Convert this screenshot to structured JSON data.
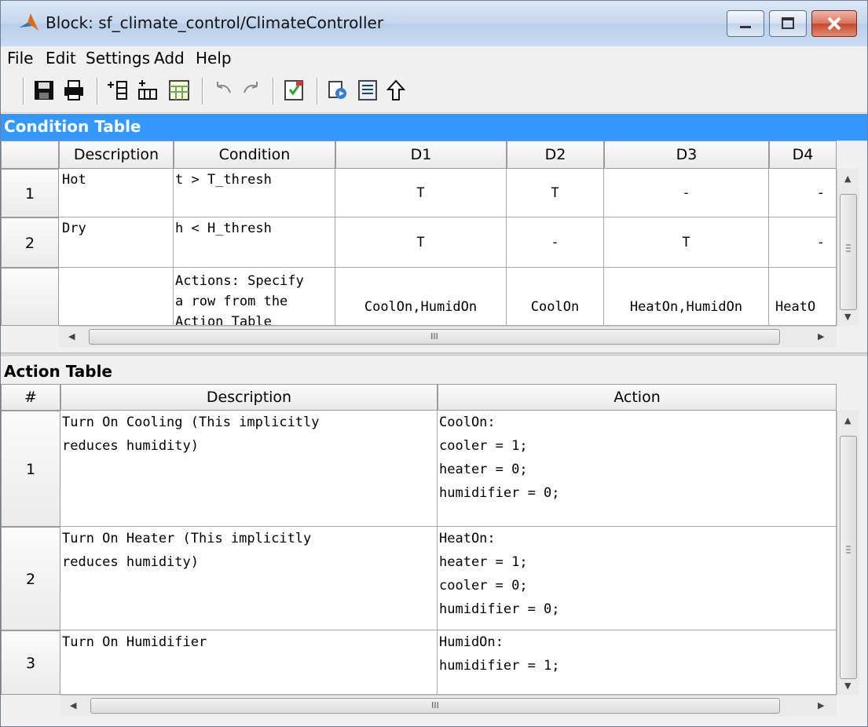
{
  "window": {
    "title": "Block: sf_climate_control/ClimateController"
  },
  "menu": [
    "File",
    "Edit",
    "Settings",
    "Add",
    "Help"
  ],
  "toolbar": [
    "save-icon",
    "print-icon",
    "insert-row-icon",
    "insert-column-icon",
    "table-icon",
    "undo-icon",
    "redo-icon",
    "check-icon",
    "run-icon",
    "data-icon",
    "up-arrow-icon"
  ],
  "condition_table": {
    "label": "Condition Table",
    "headers": [
      "Description",
      "Condition",
      "D1",
      "D2",
      "D3",
      "D4"
    ],
    "rows": [
      {
        "num": "1",
        "description": "Hot",
        "condition": "t > T_thresh",
        "decisions": [
          "T",
          "T",
          "-",
          "-"
        ]
      },
      {
        "num": "2",
        "description": "Dry",
        "condition": "h < H_thresh",
        "decisions": [
          "T",
          "-",
          "T",
          "-"
        ]
      }
    ],
    "actions_row": {
      "label": "Actions: Specify\na row from the\nAction Table",
      "values": [
        "CoolOn,HumidOn",
        "CoolOn",
        "HeatOn,HumidOn",
        "HeatO"
      ]
    },
    "hscroll_glyph": "III"
  },
  "action_table": {
    "label": "Action Table",
    "headers": [
      "#",
      "Description",
      "Action"
    ],
    "rows": [
      {
        "num": "1",
        "description": "Turn On Cooling (This implicitly\nreduces humidity)",
        "action": "CoolOn:\ncooler = 1;\nheater = 0;\nhumidifier = 0;"
      },
      {
        "num": "2",
        "description": "Turn On Heater (This implicitly\nreduces humidity)",
        "action": "HeatOn:\nheater = 1;\ncooler = 0;\nhumidifier = 0;"
      },
      {
        "num": "3",
        "description": "Turn On Humidifier",
        "action": "HumidOn:\nhumidifier = 1;"
      }
    ],
    "hscroll_glyph": "III"
  }
}
